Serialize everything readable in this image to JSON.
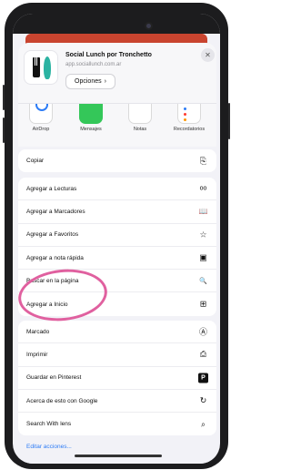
{
  "header": {
    "site_title": "Social Lunch por Tronchetto",
    "site_url": "app.sociallunch.com.ar",
    "options_label": "Opciones",
    "options_chevron": "›",
    "close_glyph": "✕"
  },
  "share_targets": [
    {
      "label": "AirDrop",
      "icon": "airdrop-icon"
    },
    {
      "label": "Mensajes",
      "icon": "messages-icon"
    },
    {
      "label": "Notas",
      "icon": "notes-icon"
    },
    {
      "label": "Recordatorios",
      "icon": "reminders-icon"
    }
  ],
  "actions_group1": [
    {
      "label": "Copiar",
      "icon": "copy-icon",
      "glyph": "⎘"
    }
  ],
  "actions_group2": [
    {
      "label": "Agregar a Lecturas",
      "icon": "glasses-icon",
      "glyph": "oo"
    },
    {
      "label": "Agregar a Marcadores",
      "icon": "book-icon",
      "glyph": "📖"
    },
    {
      "label": "Agregar a Favoritos",
      "icon": "star-icon",
      "glyph": "☆"
    },
    {
      "label": "Agregar a nota rápida",
      "icon": "quick-note-icon",
      "glyph": "▣"
    },
    {
      "label": "Buscar en la página",
      "icon": "find-in-page-icon",
      "glyph": "🔍"
    },
    {
      "label": "Agregar a Inicio",
      "icon": "add-square-icon",
      "glyph": "⊞"
    }
  ],
  "actions_group3": [
    {
      "label": "Marcado",
      "icon": "markup-icon",
      "glyph": "Ⓐ"
    },
    {
      "label": "Imprimir",
      "icon": "printer-icon",
      "glyph": "⎙"
    },
    {
      "label": "Guardar en Pinterest",
      "icon": "pinterest-icon",
      "glyph": "P"
    },
    {
      "label": "Acerca de esto con Google",
      "icon": "google-lens-icon",
      "glyph": "↻"
    },
    {
      "label": "Search With lens",
      "icon": "search-icon",
      "glyph": "⌕"
    }
  ],
  "edit_actions_label": "Editar acciones...",
  "colors": {
    "accent": "#2d7cf6",
    "highlight": "#e0609f",
    "messages_green": "#34c759"
  }
}
